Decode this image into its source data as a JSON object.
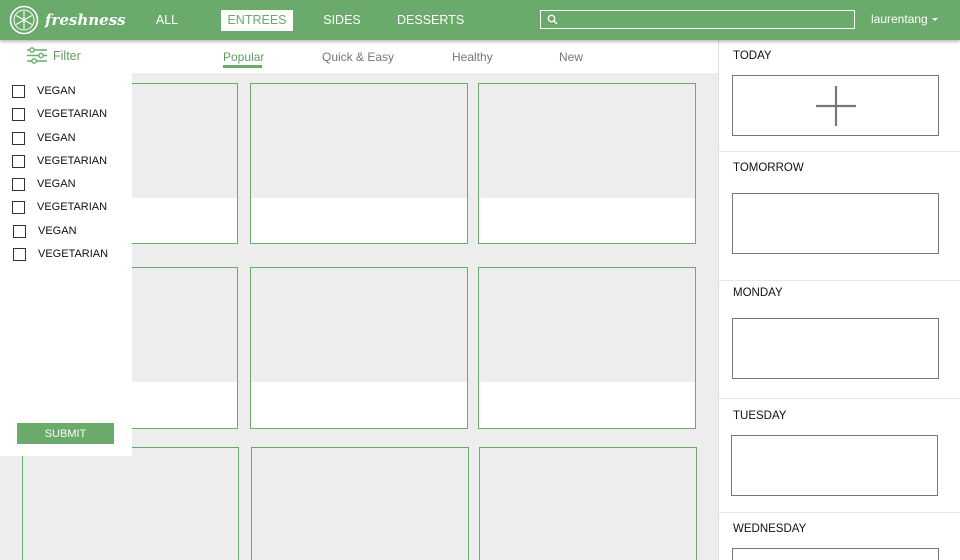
{
  "app": {
    "name": "freshness",
    "brand_color": "#6aaa6a",
    "background": "#ededed"
  },
  "nav": {
    "items": [
      {
        "label": "ALL",
        "active": false
      },
      {
        "label": "ENTREES",
        "active": true
      },
      {
        "label": "SIDES",
        "active": false
      },
      {
        "label": "DESSERTS",
        "active": false
      }
    ]
  },
  "search": {
    "icon": "search-icon",
    "value": "",
    "placeholder": ""
  },
  "user": {
    "name": "laurentang",
    "icon": "caret-down-icon"
  },
  "subnav": {
    "tabs": [
      {
        "label": "Popular",
        "active": true
      },
      {
        "label": "Quick & Easy",
        "active": false
      },
      {
        "label": "Healthy",
        "active": false
      },
      {
        "label": "New",
        "active": false
      }
    ]
  },
  "filter": {
    "label": "Filter",
    "icon": "sliders-icon",
    "options": [
      {
        "label": "VEGAN",
        "checked": false
      },
      {
        "label": "VEGETARIAN",
        "checked": false
      },
      {
        "label": "VEGAN",
        "checked": false
      },
      {
        "label": "VEGETARIAN",
        "checked": false
      },
      {
        "label": "VEGAN",
        "checked": false
      },
      {
        "label": "VEGETARIAN",
        "checked": false
      },
      {
        "label": "VEGAN",
        "checked": false
      },
      {
        "label": "VEGETARIAN",
        "checked": false
      }
    ],
    "submit_label": "SUBMIT"
  },
  "recipes": {
    "card_count": 9
  },
  "meal_plan": {
    "days": [
      {
        "label": "TODAY",
        "add_icon": "plus-icon"
      },
      {
        "label": "TOMORROW"
      },
      {
        "label": "MONDAY"
      },
      {
        "label": "TUESDAY"
      },
      {
        "label": "WEDNESDAY"
      }
    ]
  }
}
